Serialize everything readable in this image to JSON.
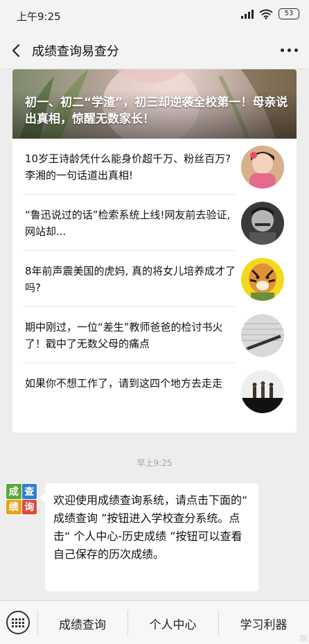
{
  "status_bar": {
    "time": "上午9:25",
    "battery": "53"
  },
  "nav": {
    "title": "成绩查询易查分",
    "back_icon": "chevron-left-icon",
    "more_icon": "more-dots-icon"
  },
  "hero": {
    "title": "初一、初二“学渣”，初三却逆袭全校第一！母亲说出真相，惊醒无数家长！"
  },
  "articles": [
    {
      "title": "10岁王诗龄凭什么能身价超千万、粉丝百万? 李湘的一句话道出真相!"
    },
    {
      "title": "“鲁迅说过的话”检索系统上线!网友前去验证,网站却..."
    },
    {
      "title": "8年前声震美国的虎妈, 真的将女儿培养成才了吗?"
    },
    {
      "title": "期中刚过，一位“差生”教师爸爸的检讨书火了！戳中了无数父母的痛点"
    },
    {
      "title": "如果你不想工作了，请到这四个地方去走走"
    }
  ],
  "chat": {
    "timestamp": "早上9:25",
    "avatar_chars": [
      "成",
      "查",
      "绩",
      "询"
    ],
    "avatar_colors": [
      "#5aa83a",
      "#2f7fd0",
      "#e7a21c",
      "#d94b3b"
    ],
    "message": "欢迎使用成绩查询系统，请点击下面的“ 成绩查询 ”按钮进入学校查分系统。点击“ 个人中心-历史成绩 ”按钮可以查看自己保存的历次成绩。"
  },
  "menu": {
    "keyboard_icon": "keyboard-icon",
    "items": [
      {
        "label": "成绩查询"
      },
      {
        "label": "个人中心"
      },
      {
        "label": "学习利器"
      }
    ]
  }
}
